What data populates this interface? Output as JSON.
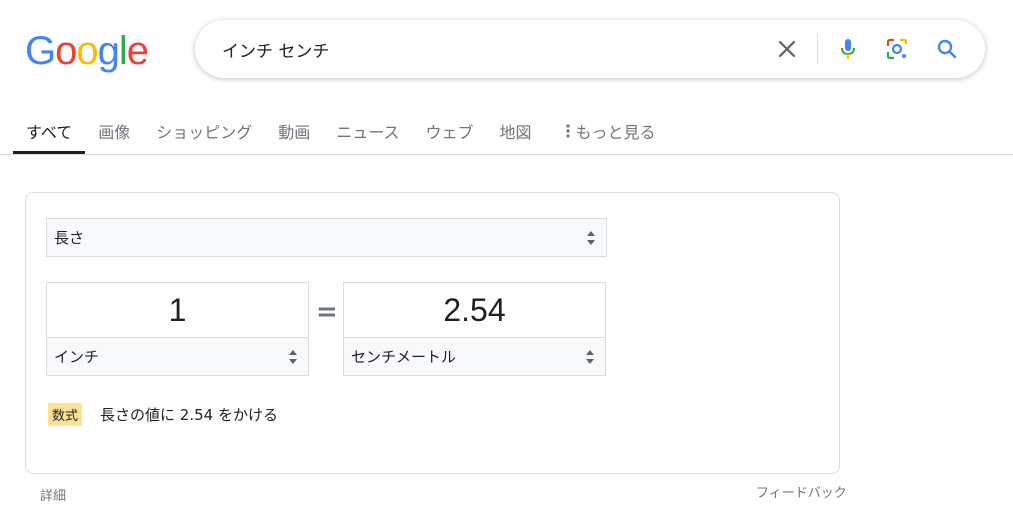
{
  "logo": {
    "letters": [
      "G",
      "o",
      "o",
      "g",
      "l",
      "e"
    ],
    "colors": [
      "#4285F4",
      "#EA4335",
      "#FBBC05",
      "#4285F4",
      "#34A853",
      "#EA4335"
    ]
  },
  "search": {
    "query": "インチ センチ",
    "icons": [
      "close-icon",
      "mic-icon",
      "lens-icon",
      "search-icon"
    ]
  },
  "tabs": [
    {
      "label": "すべて",
      "active": true
    },
    {
      "label": "画像",
      "active": false
    },
    {
      "label": "ショッピング",
      "active": false
    },
    {
      "label": "動画",
      "active": false
    },
    {
      "label": "ニュース",
      "active": false
    },
    {
      "label": "ウェブ",
      "active": false
    },
    {
      "label": "地図",
      "active": false
    },
    {
      "label": "もっと見る",
      "active": false
    }
  ],
  "converter": {
    "unit_type": "長さ",
    "from_value": "1",
    "from_unit": "インチ",
    "equals": "=",
    "to_value": "2.54",
    "to_unit": "センチメートル",
    "formula_badge": "数式",
    "formula_text": "長さの値に 2.54 をかける"
  },
  "footer": {
    "details": "詳細",
    "feedback": "フィードバック"
  },
  "colors": {
    "text": "#202124",
    "muted": "#70757a",
    "border": "#dadce0",
    "badge": "#fde293",
    "blue": "#4285F4"
  }
}
